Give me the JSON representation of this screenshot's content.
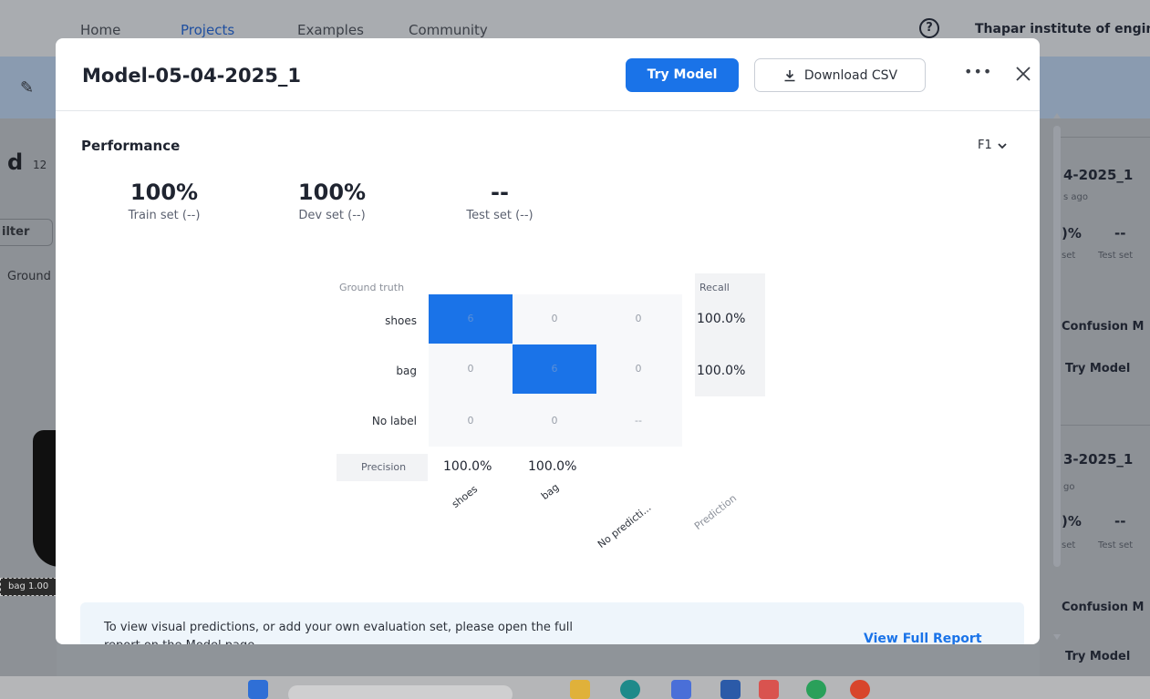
{
  "topnav": {
    "items": [
      "Home",
      "Projects",
      "Examples",
      "Community"
    ],
    "active": "Projects",
    "org_name": "Thapar institute of engine",
    "help_icon": "help-circle-icon"
  },
  "background_left": {
    "d_text": "d",
    "count_text": "12",
    "filter_label": "ilter",
    "ground_label": "Ground",
    "bag_tag": "bag 1.00"
  },
  "background_right": {
    "card1": {
      "title": "4-2025_1",
      "time": "s ago",
      "pct": ")%",
      "dash": "--",
      "set": "set",
      "test": "Test set",
      "confusion": "Confusion M",
      "try": "Try Model"
    },
    "card2": {
      "title": "3-2025_1",
      "time": "go",
      "pct": ")%",
      "dash": "--",
      "set": "set",
      "test": "Test set",
      "confusion": "Confusion M",
      "try": "Try Model"
    }
  },
  "modal": {
    "title": "Model-05-04-2025_1",
    "try_model_label": "Try Model",
    "download_label": "Download CSV",
    "more_label": "•••",
    "performance_title": "Performance",
    "metric_select": "F1",
    "metrics": [
      {
        "value": "100%",
        "label": "Train set (--)"
      },
      {
        "value": "100%",
        "label": "Dev set (--)"
      },
      {
        "value": "--",
        "label": "Test set (--)"
      }
    ],
    "confusion_matrix": {
      "ground_truth_label": "Ground truth",
      "recall_label": "Recall",
      "precision_label": "Precision",
      "prediction_label": "Prediction",
      "rows": [
        {
          "label": "shoes",
          "cells": [
            "6",
            "0",
            "0"
          ],
          "recall": "100.0%"
        },
        {
          "label": "bag",
          "cells": [
            "0",
            "6",
            "0"
          ],
          "recall": "100.0%"
        },
        {
          "label": "No label",
          "cells": [
            "0",
            "0",
            "--"
          ]
        }
      ],
      "columns": [
        "shoes",
        "bag",
        "No predicti..."
      ],
      "precision": [
        "100.0%",
        "100.0%"
      ],
      "highlight_color": "#1a73e8"
    },
    "info_text": "To view visual predictions, or add your own evaluation set, please open the full report on the Model page.",
    "view_report_label": "View Full Report"
  },
  "colors": {
    "accent": "#1a73e8",
    "overlay": "#8f9499"
  }
}
